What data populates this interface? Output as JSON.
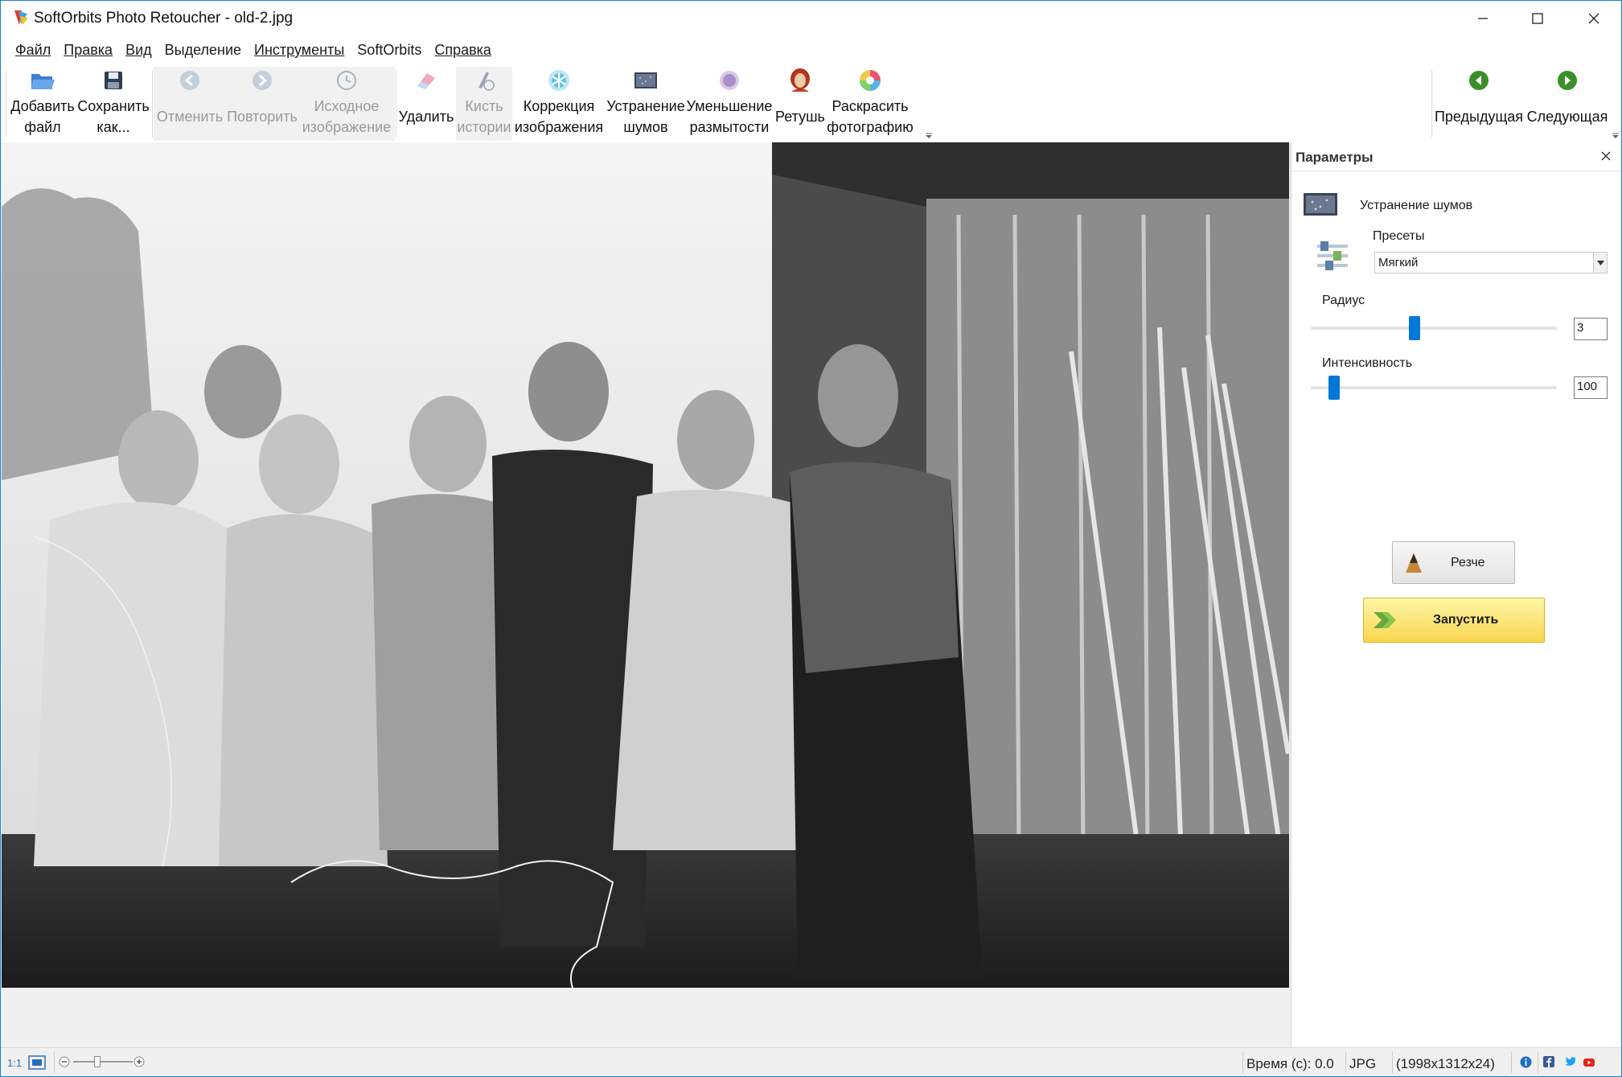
{
  "window": {
    "title": "SoftOrbits Photo Retoucher - old-2.jpg"
  },
  "menu": {
    "items": [
      {
        "label": "Файл"
      },
      {
        "label": "Правка"
      },
      {
        "label": "Вид"
      },
      {
        "label": "Выделение"
      },
      {
        "label": "Инструменты"
      },
      {
        "label": "SoftOrbits"
      },
      {
        "label": "Справка"
      }
    ]
  },
  "toolbar": {
    "add_file": "Добавить\nфайл",
    "save_as": "Сохранить\nкак...",
    "undo": "Отменить",
    "redo": "Повторить",
    "original": "Исходное\nизображение",
    "erase": "Удалить",
    "history_brush": "Кисть\nистории",
    "correction": "Коррекция\nизображения",
    "denoise": "Устранение\nшумов",
    "deblur": "Уменьшение\nразмытости",
    "retouch": "Ретушь",
    "colorize": "Раскрасить\nфотографию",
    "previous": "Предыдущая",
    "next": "Следующая"
  },
  "panel": {
    "title": "Параметры",
    "tool_name": "Устранение шумов",
    "presets_label": "Пресеты",
    "preset_value": "Мягкий",
    "radius_label": "Радиус",
    "radius_value": "3",
    "intensity_label": "Интенсивность",
    "intensity_value": "100",
    "sharper_label": "Резче",
    "run_label": "Запустить"
  },
  "status": {
    "zoom_label": "1:1",
    "time": "Время (с): 0.0",
    "format": "JPG",
    "dimensions": "(1998x1312x24)"
  },
  "colors": {
    "accent": "#0078d7",
    "run_button": "#f9d64e",
    "window_border": "#1883d7"
  }
}
